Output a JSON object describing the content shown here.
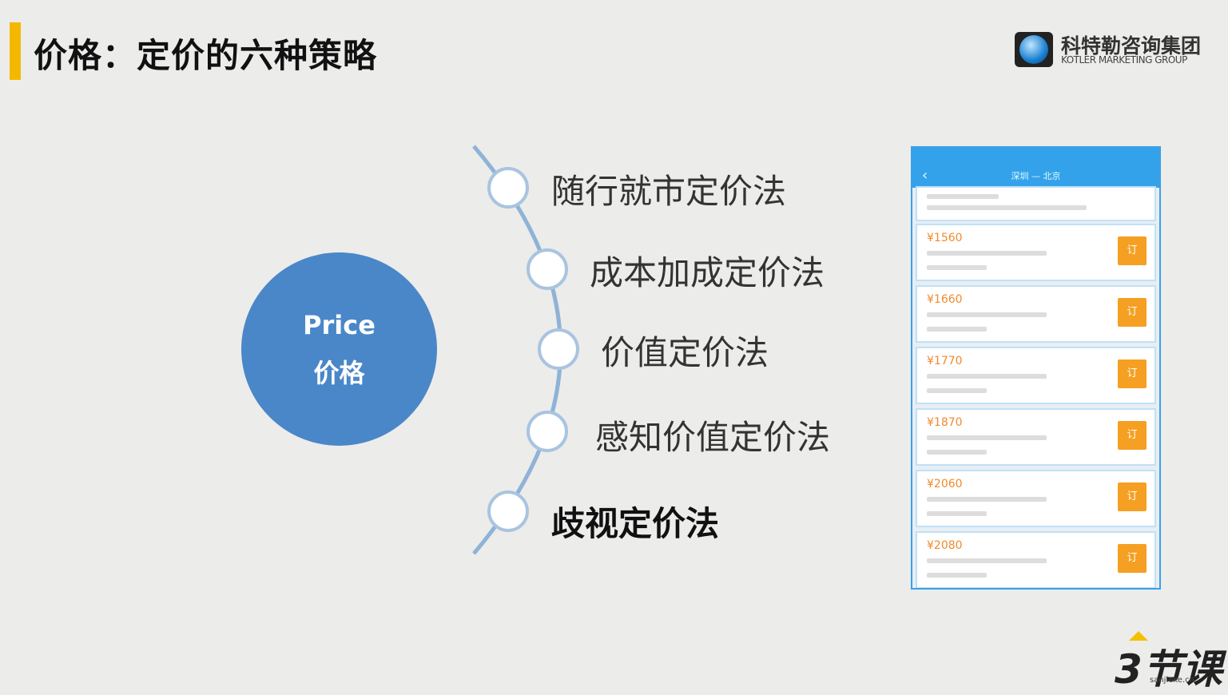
{
  "title": "价格：定价的六种策略",
  "logo": {
    "cn": "科特勒咨询集团",
    "en": "KOTLER MARKETING GROUP"
  },
  "center": {
    "en": "Price",
    "cn": "价格"
  },
  "strategies": [
    "随行就市定价法",
    "成本加成定价法",
    "价值定价法",
    "感知价值定价法",
    "歧视定价法"
  ],
  "phone": {
    "route": "深圳 — 北京",
    "prices": [
      "¥1560",
      "¥1660",
      "¥1770",
      "¥1870",
      "¥2060",
      "¥2080"
    ],
    "book": "订"
  },
  "watermark": {
    "brand": "3节课",
    "url": "sanjieke.cn"
  },
  "colors": {
    "accent": "#f5b800",
    "circle": "#4a87c8",
    "arc": "#8fb3d6"
  }
}
